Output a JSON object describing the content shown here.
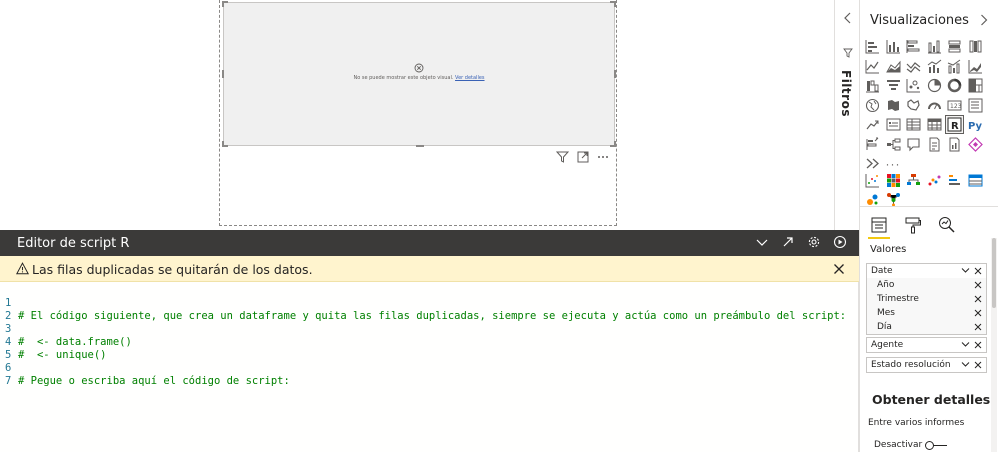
{
  "canvas": {
    "visual_error": "No se puede mostrar este objeto visual.",
    "visual_error_link": "Ver detalles"
  },
  "editor": {
    "title": "Editor de script R",
    "warning": "Las filas duplicadas se quitarán de los datos.",
    "lines": [
      {
        "n": "1",
        "text": "# El código siguiente, que crea un dataframe y quita las filas duplicadas, siempre se ejecuta y actúa como un preámbulo del script:"
      },
      {
        "n": "2",
        "text": ""
      },
      {
        "n": "3",
        "text": "#  <- data.frame()"
      },
      {
        "n": "4",
        "text": "#  <- unique()"
      },
      {
        "n": "5",
        "text": ""
      },
      {
        "n": "6",
        "text": "# Pegue o escriba aquí el código de script:"
      },
      {
        "n": "7",
        "text": ""
      }
    ]
  },
  "filters": {
    "label": "Filtros"
  },
  "viz": {
    "title": "Visualizaciones",
    "more": "···",
    "selected_icon": "r-visual-icon",
    "r_label": "R",
    "py_label": "Py",
    "values_label": "Valores",
    "fields": {
      "date": "Date",
      "date_children": [
        "Año",
        "Trimestre",
        "Mes",
        "Día"
      ],
      "agente": "Agente",
      "estado": "Estado resolución"
    },
    "details_title": "Obtener detalles",
    "cross_report": "Entre varios informes",
    "toggle_label": "Desactivar"
  },
  "colors": {
    "editor_header": "#3b3a39",
    "warning_bg": "#fff4ce",
    "code_comment": "#008000",
    "line_number": "#237893",
    "accent": "#f2c811"
  }
}
